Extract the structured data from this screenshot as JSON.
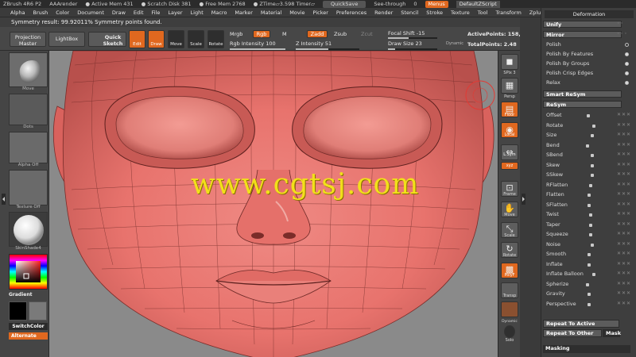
{
  "titlebar": {
    "app": "ZBrush 4R6 P2",
    "render": "AAArender",
    "active_mem": "● Active Mem 431",
    "scratch": "● Scratch Disk 381",
    "free_mem": "● Free Mem 2768",
    "ztime": "● ZTime▱3.598 Timer▱",
    "quicksave": "QuickSave",
    "seethrough_label": "See-through",
    "seethrough_value": "0",
    "menus": "Menus",
    "script": "DefaultZScript"
  },
  "menubar": [
    "Alpha",
    "Brush",
    "Color",
    "Document",
    "Draw",
    "Edit",
    "File",
    "Layer",
    "Light",
    "Macro",
    "Marker",
    "Material",
    "Movie",
    "Picker",
    "Preferences",
    "Render",
    "Stencil",
    "Stroke",
    "Texture",
    "Tool",
    "Transform",
    "Zplugin",
    "Zscript"
  ],
  "status": "Symmetry result: 99.92011% Symmetry points found.",
  "shelf": {
    "projection_master": "Projection Master",
    "lightbox": "LightBox",
    "quick_sketch": "Quick Sketch",
    "edit": "Edit",
    "draw": "Draw",
    "move": "Move",
    "scale": "Scale",
    "rotate": "Rotate",
    "mrgb": "Mrgb",
    "rgb": "Rgb",
    "m": "M",
    "zadd": "Zadd",
    "zsub": "Zsub",
    "zcut": "Zcut",
    "rgb_intensity": "Rgb Intensity 100",
    "z_intensity": "Z Intensity 51",
    "focal_shift": "Focal Shift -15",
    "draw_size": "Draw Size 23",
    "dynamic": "Dynamic",
    "active_points": "ActivePoints: 158,",
    "total_points": "TotalPoints: 2.48",
    "rgb_intensity_frac": 1.0,
    "z_intensity_frac": 0.51,
    "focal_shift_frac": 0.42,
    "draw_size_frac": 0.15
  },
  "lefttray": {
    "brush_label": "Move",
    "dots_label": "Dots",
    "alpha_label": "Alpha Off",
    "texture_label": "Texture Off",
    "material_label": "SkinShade4",
    "gradient": "Gradient",
    "switchcolor": "SwitchColor",
    "alternate": "Alternate"
  },
  "canvas": {
    "watermark": "www.cgtsj.com"
  },
  "rightshelf": [
    "SPix 3",
    "Persp",
    "Floor",
    "Local",
    "L.Sym",
    "xyz",
    "Frame",
    "Move",
    "Scale",
    "Rotate",
    "PolyF",
    "Transp",
    "Dynamic",
    "Solo"
  ],
  "palette": {
    "title": "Deformation",
    "unify": "Unify",
    "mirror": "Mirror",
    "polish": "Polish",
    "polish_features": "Polish By Features",
    "polish_groups": "Polish By Groups",
    "polish_edges": "Polish Crisp Edges",
    "relax": "Relax",
    "smart_resym": "Smart ReSym",
    "resym": "ReSym",
    "sliders": [
      "Offset",
      "Rotate",
      "Size",
      "Bend",
      "SBend",
      "Skew",
      "SSkew",
      "RFlatten",
      "Flatten",
      "SFlatten",
      "Twist",
      "Taper",
      "Squeeze",
      "Noise",
      "Smooth",
      "Inflate",
      "Inflate Balloon",
      "Spherize",
      "Gravity",
      "Perspective"
    ],
    "repeat_active": "Repeat To Active",
    "repeat_other": "Repeat To Other",
    "mask": "Mask",
    "masking": "Masking"
  },
  "colors": {
    "accent": "#e0681f",
    "skin": "#e8736d",
    "watermark": "#f2e01a"
  }
}
